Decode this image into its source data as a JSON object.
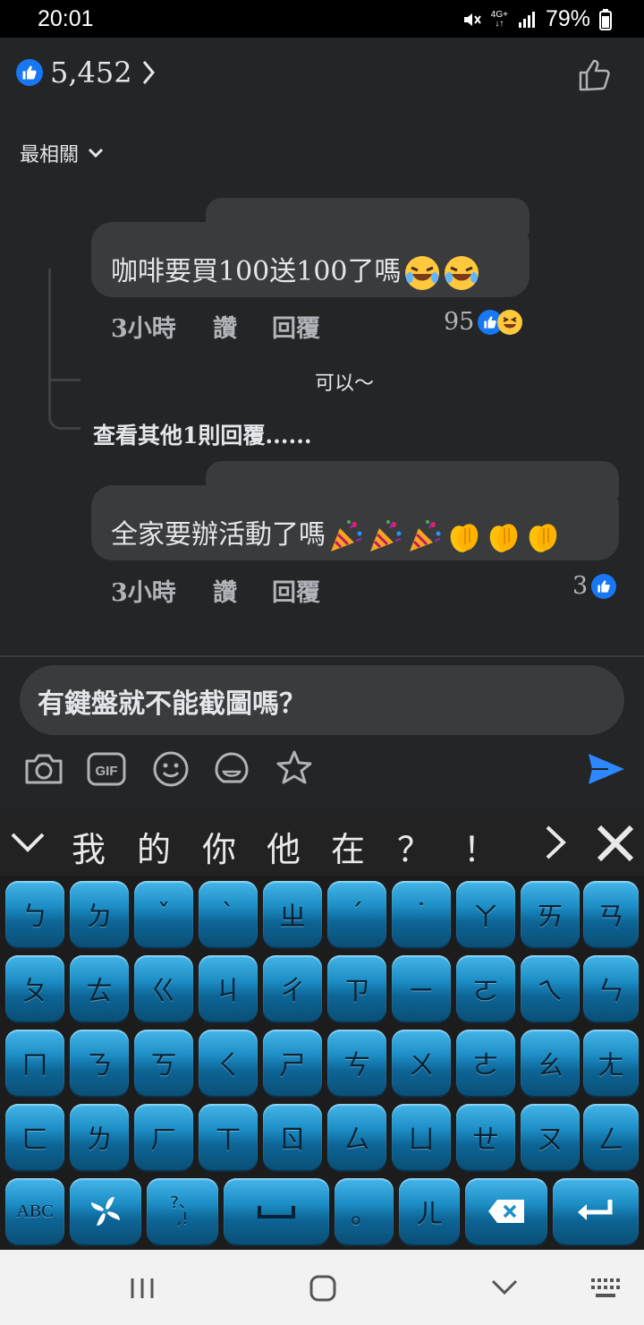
{
  "status_bar": {
    "time": "20:01",
    "network": "4G+",
    "battery": "79%"
  },
  "likes": {
    "count": "5,452"
  },
  "sort": {
    "label": "最相關"
  },
  "comments": [
    {
      "text": "咖啡要買100送100了嗎",
      "emojis": [
        "rofl-emoji",
        "rofl-emoji"
      ],
      "time": "3小時",
      "like_label": "讚",
      "reply_label": "回覆",
      "reaction_count": "95"
    },
    {
      "text": "全家要辦活動了嗎",
      "emojis": [
        "party-popper-emoji",
        "party-popper-emoji",
        "party-popper-emoji",
        "clapping-hands-emoji",
        "clapping-hands-emoji",
        "clapping-hands-emoji"
      ],
      "time": "3小時",
      "like_label": "讚",
      "reply_label": "回覆",
      "reaction_count": "3"
    }
  ],
  "reply": {
    "text": "可以～",
    "more": "查看其他1則回覆......"
  },
  "composer": {
    "text": "有鍵盤就不能截圖嗎？"
  },
  "keyboard": {
    "candidates": [
      "我",
      "的",
      "你",
      "他",
      "在",
      "？",
      "！"
    ],
    "rows": [
      [
        "ㄅ",
        "ㄉ",
        "ˇ",
        "ˋ",
        "ㄓ",
        "ˊ",
        "˙",
        "ㄚ",
        "ㄞ",
        "ㄢ"
      ],
      [
        "ㄆ",
        "ㄊ",
        "ㄍ",
        "ㄐ",
        "ㄔ",
        "ㄗ",
        "ㄧ",
        "ㄛ",
        "ㄟ",
        "ㄣ"
      ],
      [
        "ㄇ",
        "ㄋ",
        "ㄎ",
        "ㄑ",
        "ㄕ",
        "ㄘ",
        "ㄨ",
        "ㄜ",
        "ㄠ",
        "ㄤ"
      ],
      [
        "ㄈ",
        "ㄌ",
        "ㄏ",
        "ㄒ",
        "ㄖ",
        "ㄙ",
        "ㄩ",
        "ㄝ",
        "ㄡ",
        "ㄥ"
      ]
    ],
    "abc_label": "ABC",
    "punct_top": "?、",
    "punct_bottom": ",!",
    "small_circle": "。",
    "er_key": "ㄦ"
  },
  "colors": {
    "background": "#242526",
    "bubble": "#3a3b3c",
    "accent": "#1877f2",
    "key_blue": "#1d8fc6"
  }
}
